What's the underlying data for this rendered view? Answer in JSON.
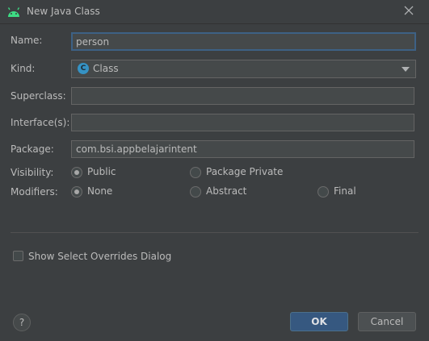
{
  "window": {
    "title": "New Java Class",
    "app_icon": "android-icon",
    "close_icon": "close-icon"
  },
  "fields": {
    "name_label": "Name:",
    "name_value": "person",
    "kind_label": "Kind:",
    "kind_value": "Class",
    "kind_icon": "C",
    "superclass_label": "Superclass:",
    "superclass_value": "",
    "interfaces_label": "Interface(s):",
    "interfaces_value": "",
    "package_label": "Package:",
    "package_value": "com.bsi.appbelajarintent"
  },
  "visibility": {
    "label": "Visibility:",
    "options": [
      "Public",
      "Package Private"
    ],
    "selected": "Public"
  },
  "modifiers": {
    "label": "Modifiers:",
    "options": [
      "None",
      "Abstract",
      "Final"
    ],
    "selected": "None"
  },
  "overrides": {
    "label": "Show Select Overrides Dialog",
    "checked": false
  },
  "buttons": {
    "help": "?",
    "ok": "OK",
    "cancel": "Cancel"
  },
  "colors": {
    "background": "#3c3f41",
    "accent_focus": "#3d6185",
    "ok_button": "#365880",
    "class_icon": "#3592c4"
  }
}
